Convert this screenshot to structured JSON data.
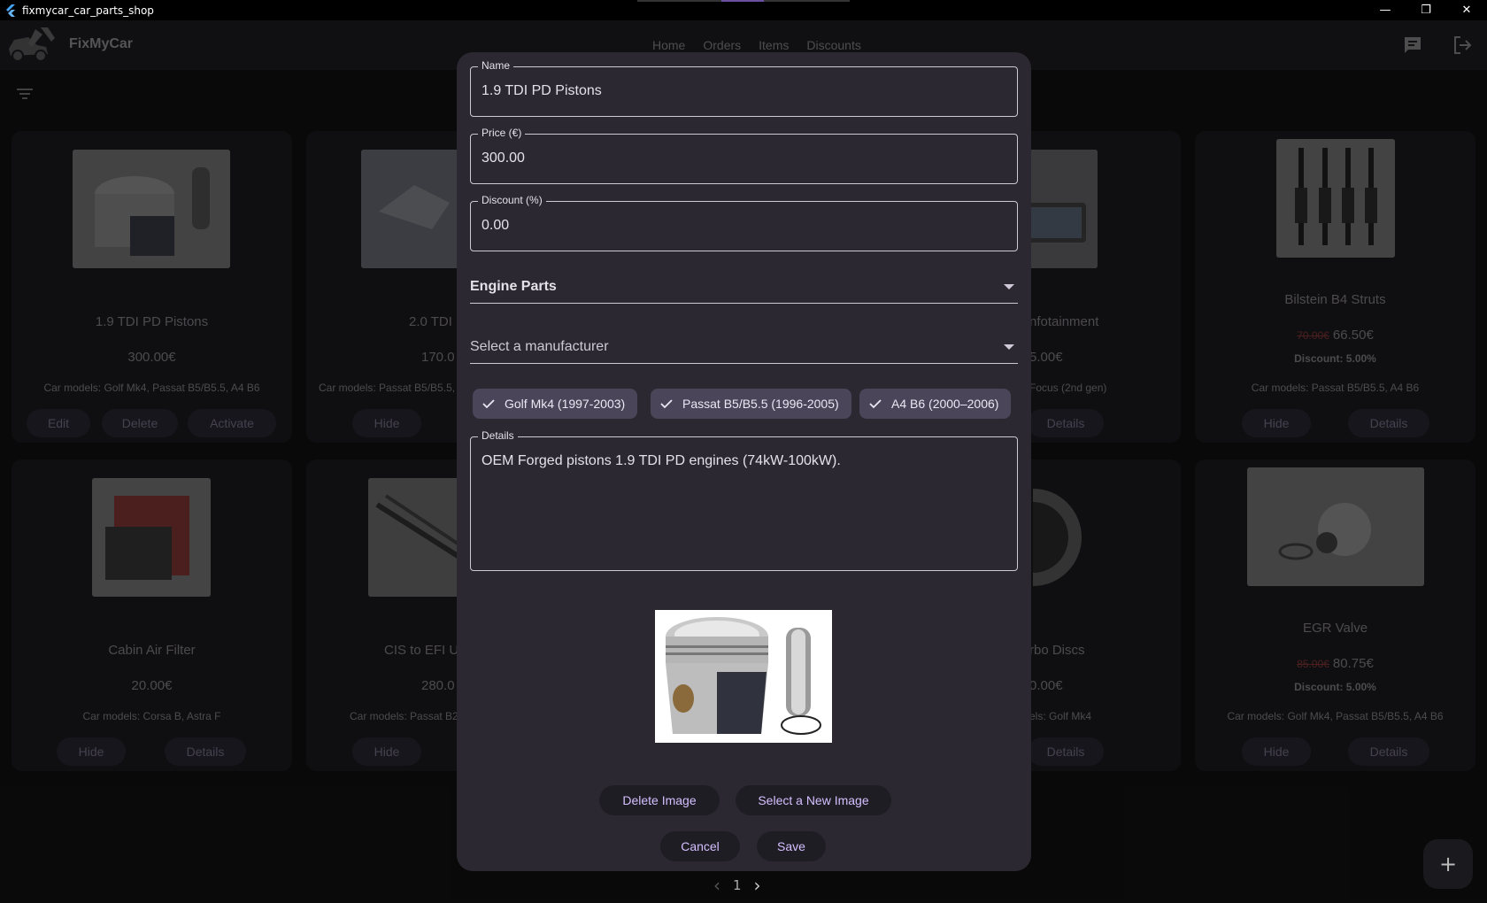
{
  "window": {
    "title": "fixmycar_car_parts_shop",
    "controls": [
      "—",
      "❐",
      "✕"
    ]
  },
  "appbar": {
    "brand": "FixMyCar",
    "nav": [
      "Home",
      "Orders",
      "Items",
      "Discounts"
    ]
  },
  "cards": [
    {
      "name": "1.9 TDI PD Pistons",
      "price": "300.00€",
      "models": "Car models: Golf Mk4, Passat B5/B5.5, A4 B6",
      "buttons": [
        "Edit",
        "Delete",
        "Activate"
      ]
    },
    {
      "name": "2.0 TDI",
      "price": "170.0",
      "models": "Car models: Passat B5/B5.5,",
      "buttons": [
        "Hide"
      ]
    },
    {
      "name": "nfotainment",
      "price": "5.00€",
      "models": "Focus (2nd gen)",
      "buttons": [
        "Details"
      ]
    },
    {
      "name": "Bilstein B4 Struts",
      "old_price": "70.00€",
      "price": "66.50€",
      "discount": "Discount: 5.00%",
      "models": "Car models: Passat B5/B5.5, A4 B6",
      "buttons": [
        "Hide",
        "Details"
      ]
    },
    {
      "name": "Cabin Air Filter",
      "price": "20.00€",
      "models": "Car models: Corsa B, Astra F",
      "buttons": [
        "Hide",
        "Details"
      ]
    },
    {
      "name": "CIS to EFI U",
      "price": "280.0",
      "models": "Car models: Passat B2",
      "buttons": [
        "Hide"
      ]
    },
    {
      "name": "rbo Discs",
      "price": "0.00€",
      "models": "els: Golf Mk4",
      "buttons": [
        "Details"
      ]
    },
    {
      "name": "EGR Valve",
      "old_price": "85.00€",
      "price": "80.75€",
      "discount": "Discount: 5.00%",
      "models": "Car models: Golf Mk4, Passat B5/B5.5, A4 B6",
      "buttons": [
        "Hide",
        "Details"
      ]
    }
  ],
  "dialog": {
    "name_label": "Name",
    "name_value": "1.9 TDI PD Pistons",
    "price_label": "Price (€)",
    "price_value": "300.00",
    "discount_label": "Discount (%)",
    "discount_value": "0.00",
    "category_value": "Engine Parts",
    "manufacturer_placeholder": "Select a manufacturer",
    "chips": [
      "Golf Mk4 (1997-2003)",
      "Passat B5/B5.5 (1996-2005)",
      "A4 B6 (2000–2006)"
    ],
    "details_label": "Details",
    "details_value": "OEM Forged pistons 1.9 TDI PD engines (74kW-100kW).",
    "delete_image": "Delete Image",
    "select_image": "Select a New Image",
    "cancel": "Cancel",
    "save": "Save"
  },
  "pager": {
    "page": "1"
  },
  "fab": {
    "label": "+"
  },
  "colors": {
    "accent": "#d4bfff",
    "chip": "#4a4558",
    "dialog": "#2b2831"
  }
}
